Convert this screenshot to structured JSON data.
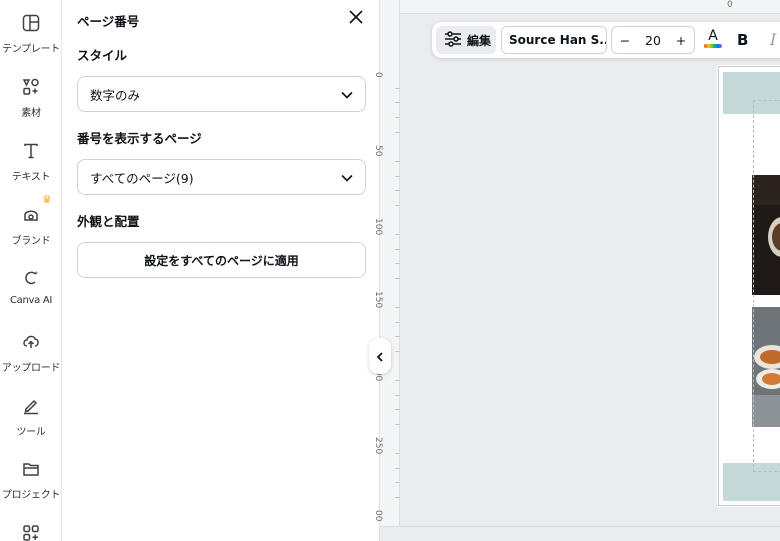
{
  "rail": {
    "items": [
      {
        "label": "テンプレート",
        "icon": "template-icon"
      },
      {
        "label": "素材",
        "icon": "elements-icon"
      },
      {
        "label": "テキスト",
        "icon": "text-icon"
      },
      {
        "label": "ブランド",
        "icon": "brand-icon"
      },
      {
        "label": "Canva AI",
        "icon": "canva-ai-icon"
      },
      {
        "label": "アップロード",
        "icon": "upload-icon"
      },
      {
        "label": "ツール",
        "icon": "tools-icon"
      },
      {
        "label": "プロジェクト",
        "icon": "folder-icon"
      },
      {
        "label": "",
        "icon": "apps-icon"
      }
    ]
  },
  "panel": {
    "title": "ページ番号",
    "style_heading": "スタイル",
    "style_value": "数字のみ",
    "pages_heading": "番号を表示するページ",
    "pages_value": "すべてのページ(9)",
    "appearance_heading": "外観と配置",
    "apply_label": "設定をすべてのページに適用"
  },
  "toolbar": {
    "edit_label": "編集",
    "font_name": "Source Han S...",
    "font_size": "20",
    "minus": "−",
    "plus": "+",
    "color_letter": "A",
    "bold": "B",
    "italic": "I"
  },
  "ruler": {
    "vertical": [
      "0",
      "50",
      "100",
      "150",
      "200",
      "250",
      "00"
    ],
    "horizontal": [
      "0"
    ]
  },
  "colors": {
    "accent_band": "#c6d9d9",
    "crown": "#f5a623"
  }
}
